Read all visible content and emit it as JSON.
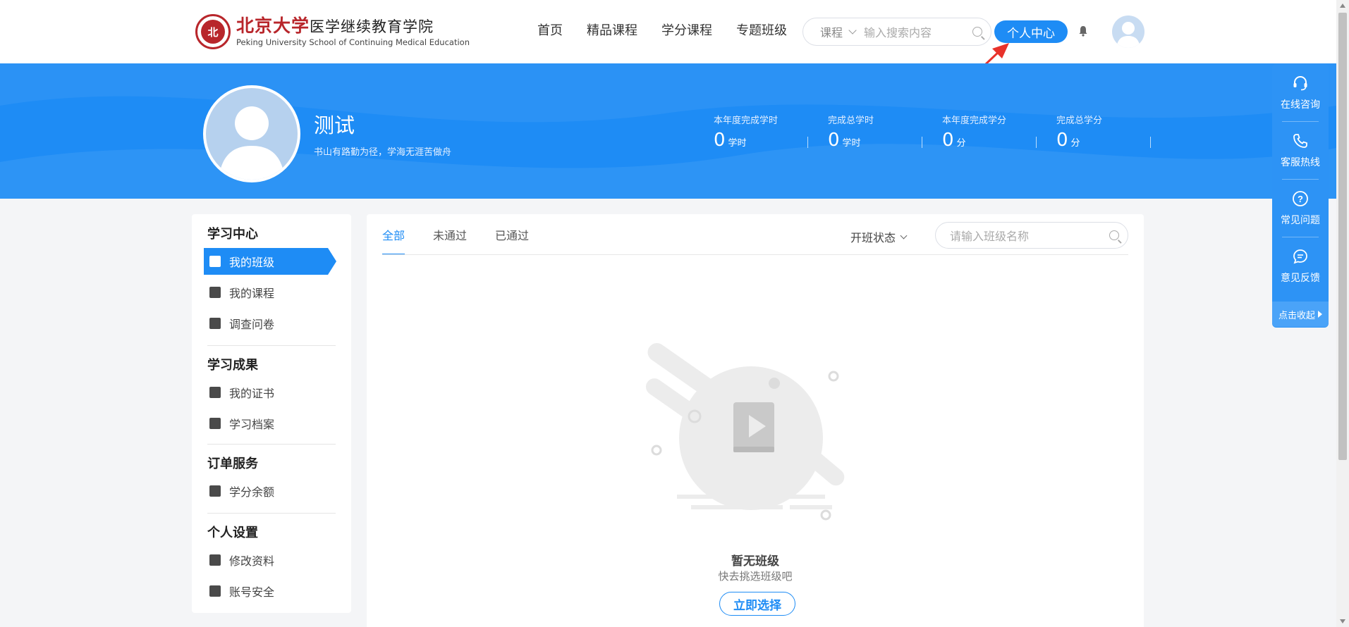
{
  "header": {
    "logo_cn": "北京大学",
    "logo_cn_sub": "医学继续教育学院",
    "logo_en": "Peking University School of Continuing Medical Education",
    "logo_seal_text": "北",
    "nav": [
      "首页",
      "精品课程",
      "学分课程",
      "专题班级"
    ],
    "search_category": "课程",
    "search_placeholder": "输入搜索内容",
    "personal_center": "个人中心"
  },
  "profile": {
    "name": "测试",
    "motto": "书山有路勤为径，学海无涯苦做舟",
    "stats": [
      {
        "label": "本年度完成学时",
        "value": "0",
        "unit": "学时"
      },
      {
        "label": "完成总学时",
        "value": "0",
        "unit": "学时"
      },
      {
        "label": "本年度完成学分",
        "value": "0",
        "unit": "分"
      },
      {
        "label": "完成总学分",
        "value": "0",
        "unit": "分"
      }
    ]
  },
  "sidebar": {
    "sections": [
      {
        "title": "学习中心",
        "items": [
          "我的班级",
          "我的课程",
          "调查问卷"
        ]
      },
      {
        "title": "学习成果",
        "items": [
          "我的证书",
          "学习档案"
        ]
      },
      {
        "title": "订单服务",
        "items": [
          "学分余额"
        ]
      },
      {
        "title": "个人设置",
        "items": [
          "修改资料",
          "账号安全"
        ]
      }
    ]
  },
  "main": {
    "tabs": [
      "全部",
      "未通过",
      "已通过"
    ],
    "filter_label": "开班状态",
    "class_search_placeholder": "请输入班级名称",
    "empty_title": "暂无班级",
    "empty_subtitle": "快去挑选班级吧",
    "choose_button": "立即选择"
  },
  "float_bar": {
    "items": [
      "在线咨询",
      "客服热线",
      "常见问题",
      "意见反馈"
    ],
    "collapse": "点击收起"
  },
  "colors": {
    "primary": "#1e8cf5",
    "brand_red": "#b8262b"
  }
}
